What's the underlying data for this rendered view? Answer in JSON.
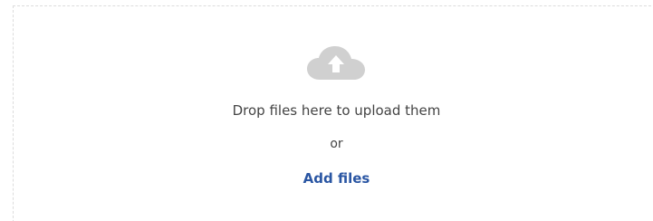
{
  "dropzone": {
    "icon": "cloud-upload-icon",
    "instruction": "Drop files here to upload them",
    "separator": "or",
    "add_files_label": "Add files"
  },
  "colors": {
    "icon": "#d0d0d0",
    "text": "#444444",
    "link": "#2a56a3",
    "border": "#dcdcdc"
  }
}
